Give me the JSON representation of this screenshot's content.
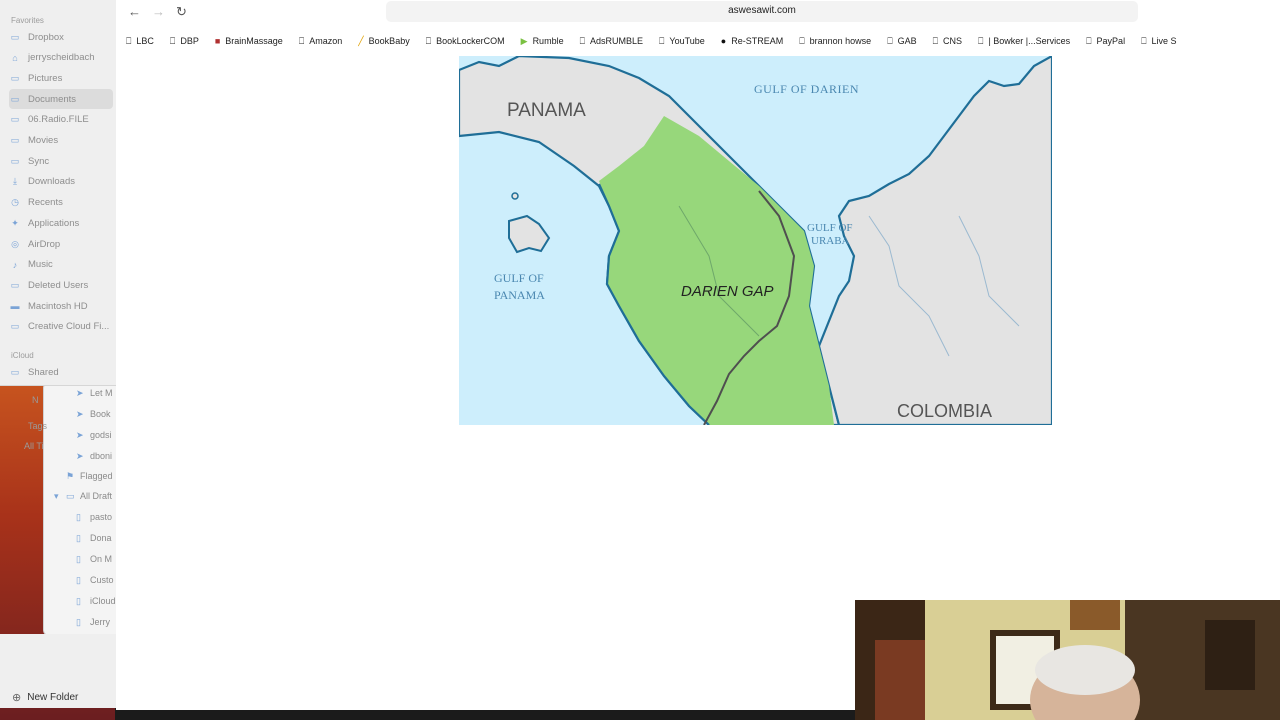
{
  "finder": {
    "sections": {
      "favorites": "Favorites",
      "icloud": "iCloud"
    },
    "items": [
      {
        "label": "Dropbox",
        "icon": "folder-icon"
      },
      {
        "label": "jerryscheidbach",
        "icon": "home-icon"
      },
      {
        "label": "Pictures",
        "icon": "folder-icon"
      },
      {
        "label": "Documents",
        "icon": "folder-icon"
      },
      {
        "label": "06.Radio.FILE",
        "icon": "folder-icon"
      },
      {
        "label": "Movies",
        "icon": "folder-icon"
      },
      {
        "label": "Sync",
        "icon": "folder-icon"
      },
      {
        "label": "Downloads",
        "icon": "download-icon"
      },
      {
        "label": "Recents",
        "icon": "clock-icon"
      },
      {
        "label": "Applications",
        "icon": "applications-icon"
      },
      {
        "label": "AirDrop",
        "icon": "airdrop-icon"
      },
      {
        "label": "Music",
        "icon": "music-icon"
      },
      {
        "label": "Deleted Users",
        "icon": "folder-icon"
      },
      {
        "label": "Macintosh HD",
        "icon": "disk-icon"
      },
      {
        "label": "Creative Cloud Fi...",
        "icon": "folder-icon"
      }
    ],
    "icloud_items": [
      {
        "label": "Shared",
        "icon": "shared-folder-icon"
      }
    ],
    "new_folder": "New Folder"
  },
  "finder_back": {
    "tags_label": "Tags",
    "items": [
      "Let M",
      "Book",
      "godsi",
      "dboni",
      "Flagged",
      "All Draft",
      "pasto",
      "Dona",
      "On M",
      "Custo",
      "iCloud",
      "Jerry"
    ],
    "other": [
      "N",
      "All Ti"
    ]
  },
  "browser": {
    "url": "aswesawit.com",
    "bookmarks": [
      {
        "label": "LBC",
        "icon": "bookmark-icon"
      },
      {
        "label": "DBP",
        "icon": "bookmark-icon"
      },
      {
        "label": "BrainMassage",
        "icon": "brainmassage-favicon"
      },
      {
        "label": "Amazon",
        "icon": "bookmark-icon"
      },
      {
        "label": "BookBaby",
        "icon": "bookbaby-favicon"
      },
      {
        "label": "BookLockerCOM",
        "icon": "bookmark-icon"
      },
      {
        "label": "Rumble",
        "icon": "rumble-favicon"
      },
      {
        "label": "AdsRUMBLE",
        "icon": "bookmark-icon"
      },
      {
        "label": "YouTube",
        "icon": "bookmark-icon"
      },
      {
        "label": "Re-STREAM",
        "icon": "restream-favicon"
      },
      {
        "label": "brannon howse",
        "icon": "bookmark-icon"
      },
      {
        "label": "GAB",
        "icon": "bookmark-icon"
      },
      {
        "label": "CNS",
        "icon": "bookmark-icon"
      },
      {
        "label": "| Bowker |...Services",
        "icon": "bookmark-icon"
      },
      {
        "label": "PayPal",
        "icon": "bookmark-icon"
      },
      {
        "label": "Live S",
        "icon": "bookmark-icon"
      }
    ]
  },
  "map": {
    "labels": {
      "panama": "PANAMA",
      "gulf_darien": "GULF OF DARIEN",
      "gulf_uraba_1": "GULF OF",
      "gulf_uraba_2": "URABA",
      "gulf_panama_1": "GULF OF",
      "gulf_panama_2": "PANAMA",
      "darien_gap": "DARIEN GAP",
      "colombia": "COLOMBIA"
    },
    "colors": {
      "sea": "#cdeefc",
      "land": "#e3e3e3",
      "gap": "#97d77b",
      "coast": "#1f6e97",
      "border": "#4f4f4f"
    }
  },
  "webcam": {
    "description_icon": "webcam-video-feed"
  }
}
